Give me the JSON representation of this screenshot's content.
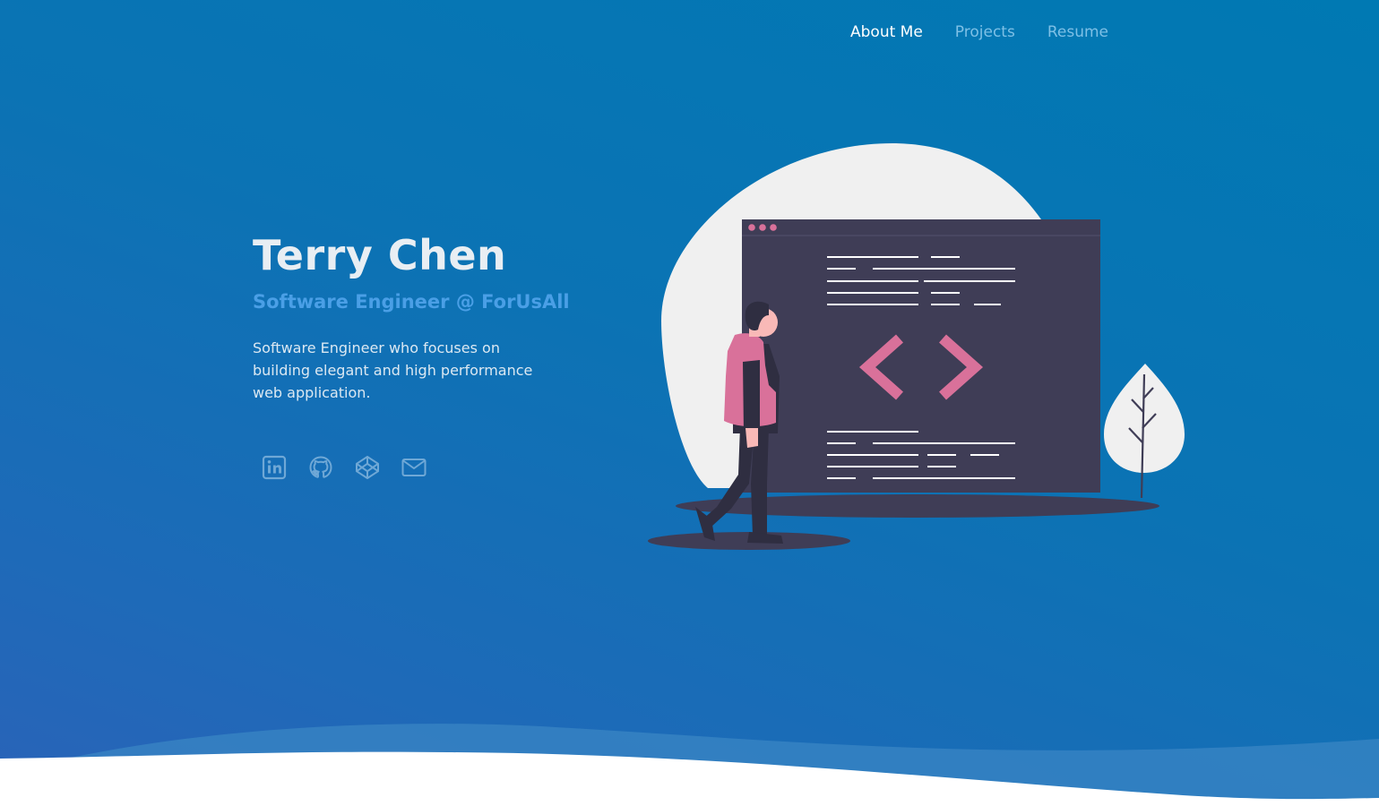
{
  "nav": {
    "items": [
      {
        "label": "About Me",
        "active": true
      },
      {
        "label": "Projects",
        "active": false
      },
      {
        "label": "Resume",
        "active": false
      }
    ]
  },
  "hero": {
    "name": "Terry Chen",
    "role": "Software Engineer @ ForUsAll",
    "bio": "Software Engineer who focuses on building elegant and high performance web application."
  },
  "socials": [
    {
      "icon": "linkedin-icon"
    },
    {
      "icon": "github-icon"
    },
    {
      "icon": "codepen-icon"
    },
    {
      "icon": "mail-icon"
    }
  ],
  "colors": {
    "accent_pink": "#d9719a",
    "screen_dark": "#3f3d56",
    "nav_active": "#ffffff",
    "nav_inactive": "#7ec0e6",
    "role_blue": "#4a9fe6"
  }
}
